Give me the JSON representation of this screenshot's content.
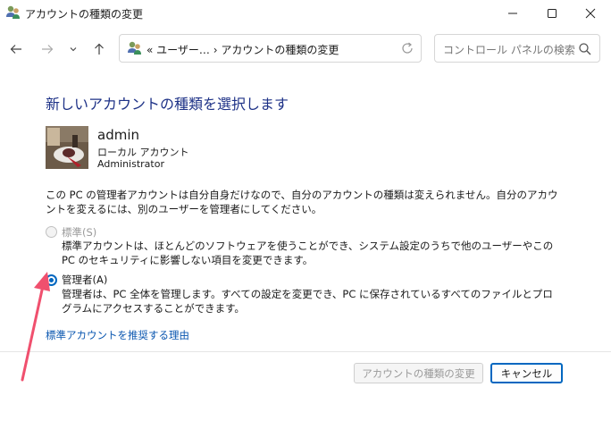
{
  "window": {
    "title": "アカウントの種類の変更",
    "controls": {
      "minimize": "─",
      "maximize": "☐",
      "close": "✕"
    }
  },
  "nav": {
    "back_icon": "back-arrow",
    "forward_icon": "forward-arrow",
    "recent_icon": "chevron-down",
    "up_icon": "up-arrow",
    "address_text": "«  ユーザー…  ›  アカウントの種類の変更",
    "search_placeholder": "コントロール パネルの検索"
  },
  "content": {
    "heading": "新しいアカウントの種類を選択します",
    "account": {
      "name": "admin",
      "type": "ローカル アカウント",
      "role": "Administrator"
    },
    "description": "この PC の管理者アカウントは自分自身だけなので、自分のアカウントの種類は変えられません。自分のアカウントを変えるには、別のユーザーを管理者にしてください。",
    "options": {
      "standard": {
        "label": "標準(S)",
        "description": "標準アカウントは、ほとんどのソフトウェアを使うことができ、システム設定のうちで他のユーザーやこの PC のセキュリティに影響しない項目を変更できます。",
        "selected": false,
        "enabled": false
      },
      "admin": {
        "label": "管理者(A)",
        "description": "管理者は、PC 全体を管理します。すべての設定を変更でき、PC に保存されているすべてのファイルとプログラムにアクセスすることができます。",
        "selected": true,
        "enabled": true
      }
    },
    "link": "標準アカウントを推奨する理由"
  },
  "buttons": {
    "change": "アカウントの種類の変更",
    "cancel": "キャンセル"
  },
  "colors": {
    "heading": "#1e3287",
    "link": "#0b57b0",
    "accent": "#0067c0",
    "annotation_arrow": "#f0506e"
  }
}
